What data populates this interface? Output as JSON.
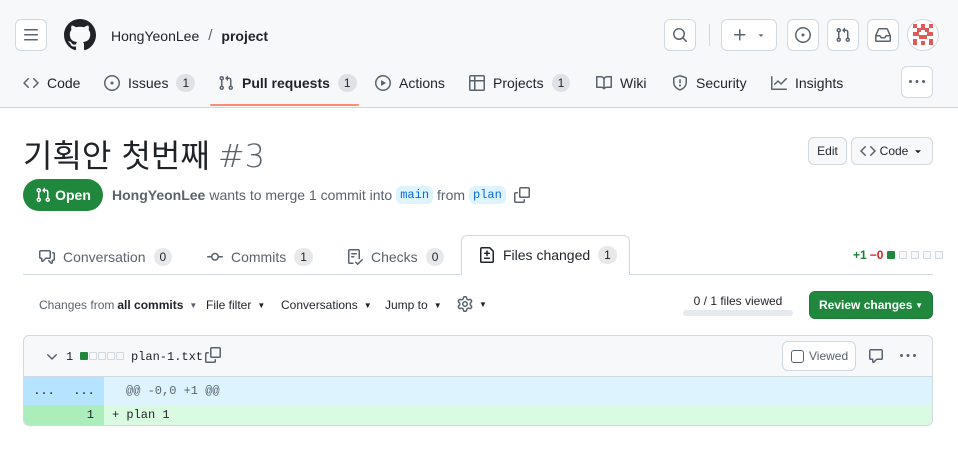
{
  "header": {
    "owner": "HongYeonLee",
    "separator": "/",
    "repo": "project"
  },
  "nav": {
    "code": "Code",
    "issues": "Issues",
    "issues_count": "1",
    "pull_requests": "Pull requests",
    "pull_requests_count": "1",
    "actions": "Actions",
    "projects": "Projects",
    "projects_count": "1",
    "wiki": "Wiki",
    "security": "Security",
    "insights": "Insights"
  },
  "pr": {
    "title": "기획안 첫번째",
    "number": "#3",
    "edit_label": "Edit",
    "code_label": "Code",
    "state": "Open",
    "author": "HongYeonLee",
    "meta_text": "wants to merge 1 commit into",
    "base_branch": "main",
    "from_text": "from",
    "head_branch": "plan"
  },
  "tabs": {
    "conversation": "Conversation",
    "conversation_count": "0",
    "commits": "Commits",
    "commits_count": "1",
    "checks": "Checks",
    "checks_count": "0",
    "files_changed": "Files changed",
    "files_changed_count": "1"
  },
  "diffstat": {
    "additions": "+1",
    "deletions": "−0"
  },
  "toolbar": {
    "changes_from_prefix": "Changes from",
    "changes_from_value": "all commits",
    "file_filter": "File filter",
    "conversations": "Conversations",
    "jump_to": "Jump to",
    "files_viewed": "0 / 1 files viewed",
    "files_viewed_fraction": 0,
    "review_changes": "Review changes"
  },
  "file": {
    "change_count": "1",
    "name": "plan-1.txt",
    "viewed_label": "Viewed",
    "hunk_left": "...",
    "hunk_right": "...",
    "hunk_header": "@@ -0,0 +1 @@",
    "line_number": "1",
    "line_text": "+ plan 1"
  },
  "colors": {
    "accent_green": "#1f883d",
    "nav_underline": "#fd8c73",
    "hunk_bg": "#ddf4ff",
    "addition_bg": "#dafbe1"
  }
}
